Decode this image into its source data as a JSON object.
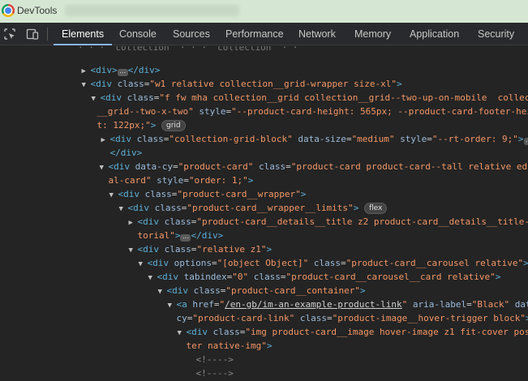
{
  "window": {
    "title": "DevTools"
  },
  "tabs": [
    "Elements",
    "Console",
    "Sources",
    "Performance",
    "Network",
    "Memory",
    "Application",
    "Security"
  ],
  "active_tab": "Elements",
  "colors": {
    "title_bar": "#d5e7d3",
    "panel_bg": "#242424",
    "tag": "#5db0d7",
    "attr_name": "#9bbbdc",
    "attr_value": "#f29766",
    "active_tab_underline": "#8ab4f8"
  },
  "tree": {
    "clipped_top": "· · ·  collection  · · ·  collection  · ·",
    "l1": {
      "open": "<div>",
      "close": "</div>"
    },
    "l2": {
      "open": "<div",
      "attr": "class",
      "value": "\"w1 relative collection__grid-wrapper size-xl\"",
      "end": ">"
    },
    "l3": {
      "open": "<div",
      "attr": "class",
      "value": "\"f fw mha collection__grid collection__grid--two-up-on-mobile  collection",
      "end": ""
    },
    "l3b": {
      "value": "__grid--two-x-two\"",
      "attr2": "style",
      "value2": "\"--product-card-height: 565px; --product-card-footer-heigh"
    },
    "l3c": {
      "value": "t: 122px;\"",
      "end": ">",
      "badge": "grid"
    },
    "l4": {
      "open": "<div",
      "attr": "class",
      "value": "\"collection-grid-block\"",
      "attr2": "data-size",
      "value2": "\"medium\"",
      "attr3": "style",
      "value3": "\"--rt-order: 9;\"",
      "end": ">"
    },
    "l5": {
      "close": "</div>"
    },
    "l6": {
      "open": "<div",
      "attr": "data-cy",
      "value": "\"product-card\"",
      "attr2": "class",
      "value2": "\"product-card product-card--tall relative editori"
    },
    "l6b": {
      "value": "al-card\"",
      "attr2": "style",
      "value2": "\"order: 1;\"",
      "end": ">"
    },
    "l7": {
      "open": "<div",
      "attr": "class",
      "value": "\"product-card__wrapper\"",
      "end": ">"
    },
    "l8": {
      "open": "<div",
      "attr": "class",
      "value": "\"product-card__wrapper__limits\"",
      "end": ">",
      "badge": "flex"
    },
    "l9": {
      "open": "<div",
      "attr": "class",
      "value": "\"product-card__details__title z2 product-card__details__title--edi"
    },
    "l9b": {
      "value": "torial\"",
      "end": ">",
      "close": "</div>"
    },
    "l10": {
      "open": "<div",
      "attr": "class",
      "value": "\"relative z1\"",
      "end": ">"
    },
    "l11": {
      "open": "<div",
      "attr": "options",
      "value": "\"[object Object]\"",
      "attr2": "class",
      "value2": "\"product-card__carousel relative\"",
      "end": ">"
    },
    "l12": {
      "open": "<div",
      "attr": "tabindex",
      "value": "\"0\"",
      "attr2": "class",
      "value2": "\"product-card__carousel__card relative\"",
      "end": ">"
    },
    "l13": {
      "open": "<div",
      "attr": "class",
      "value": "\"product-card__container\"",
      "end": ">"
    },
    "l14": {
      "open": "<a",
      "attr": "href",
      "value_pre": "\"",
      "link": "/en-gb/im-an-example-product-link",
      "value_post": "\"",
      "attr2": "aria-label",
      "value2": "\"Black\"",
      "attr3": "data-"
    },
    "l14b": {
      "attr": "cy",
      "value": "\"product-card-link\"",
      "attr2": "class",
      "value2": "\"product-image__hover-trigger block\"",
      "end": ">"
    },
    "l15": {
      "open": "<div",
      "attr": "class",
      "value": "\"img product-card__image hover-image z1 fit-cover pos-cen"
    },
    "l15b": {
      "value": "ter native-img\"",
      "end": ">"
    },
    "comment": "<!---->"
  }
}
